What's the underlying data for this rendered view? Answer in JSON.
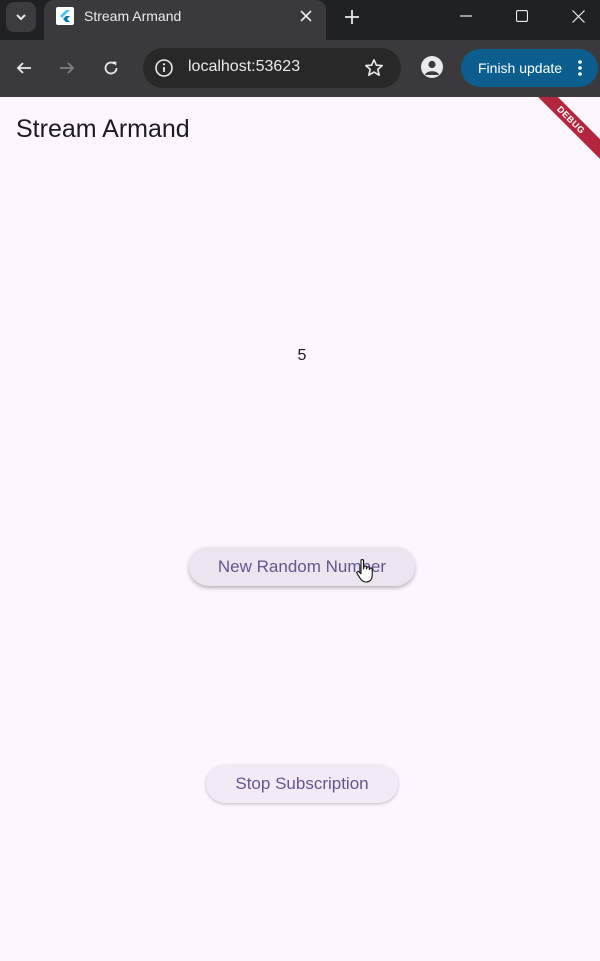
{
  "browser": {
    "tab": {
      "title": "Stream Armand"
    },
    "address_bar": {
      "url": "localhost:53623"
    },
    "finish_update_label": "Finish update"
  },
  "app": {
    "title": "Stream Armand",
    "debug_banner": "DEBUG",
    "random_number": "5",
    "buttons": {
      "new_random": "New Random Number",
      "stop_subscription": "Stop Subscription"
    }
  },
  "colors": {
    "app_background": "#fdf6fe",
    "button_text": "#65558f",
    "debug_banner": "#b3263e",
    "update_button": "#0b5e8e"
  }
}
